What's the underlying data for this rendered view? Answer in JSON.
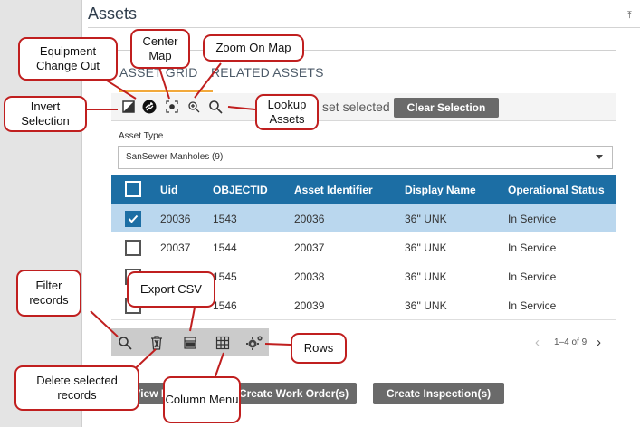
{
  "panel": {
    "title": "Assets"
  },
  "tabs": [
    {
      "label": "ASSET GRID",
      "active": true
    },
    {
      "label": "RELATED ASSETS",
      "active": false
    }
  ],
  "selection": {
    "text": "set selected",
    "clear_label": "Clear Selection"
  },
  "asset_type": {
    "label": "Asset Type",
    "value": "SanSewer Manholes (9)"
  },
  "table": {
    "columns": [
      "Uid",
      "OBJECTID",
      "Asset Identifier",
      "Display Name",
      "Operational Status"
    ],
    "rows": [
      {
        "cells": [
          "20036",
          "1543",
          "20036",
          "36'' UNK",
          "In Service"
        ],
        "checked": true
      },
      {
        "cells": [
          "20037",
          "1544",
          "20037",
          "36'' UNK",
          "In Service"
        ],
        "checked": false
      },
      {
        "cells": [
          "",
          "1545",
          "20038",
          "36'' UNK",
          "In Service"
        ],
        "checked": false
      },
      {
        "cells": [
          "",
          "1546",
          "20039",
          "36'' UNK",
          "In Service"
        ],
        "checked": false
      }
    ]
  },
  "pager": {
    "text": "1–4 of 9"
  },
  "buttons": {
    "view": "View D",
    "create_work_order": "Create Work Order(s)",
    "create_inspection": "Create Inspection(s)"
  },
  "callouts": {
    "equipment_change_out": "Equipment Change Out",
    "center_map": "Center Map",
    "zoom_on_map": "Zoom On Map",
    "invert_selection": "Invert Selection",
    "lookup_assets": "Lookup Assets",
    "filter_records": "Filter records",
    "export_csv": "Export CSV",
    "rows": "Rows",
    "delete_selected_records": "Delete selected records",
    "column_menu": "Column Menu"
  },
  "colors": {
    "header_blue": "#1c6ea4",
    "selected_row": "#bad7ee",
    "tab_accent": "#f2a93b",
    "callout_border": "#c01f1f"
  }
}
